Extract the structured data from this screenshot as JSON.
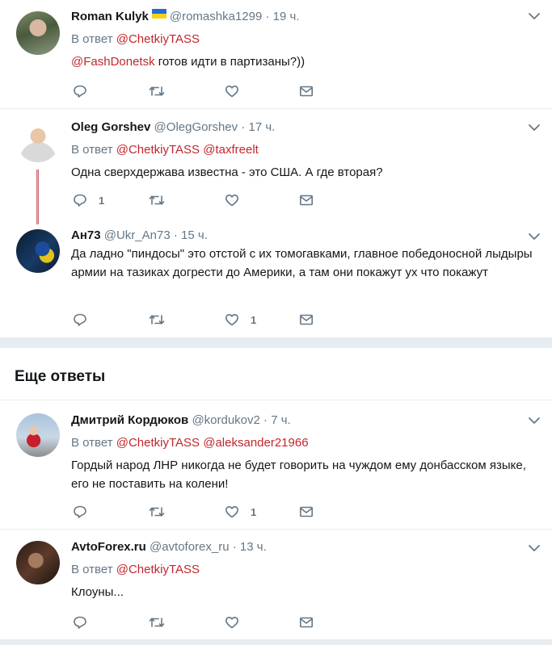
{
  "tweets": [
    {
      "name": "Roman Kulyk",
      "handle": "@romashka1299",
      "dot": "·",
      "time": "19 ч.",
      "reply_prefix": "В ответ",
      "reply_to": [
        "@ChetkiyTASS"
      ],
      "text_mention": "@FashDonetsk",
      "text": " готов идти в партизаны?))",
      "reply_count": "",
      "like_count": ""
    },
    {
      "name": "Oleg Gorshev",
      "handle": "@OlegGorshev",
      "dot": "·",
      "time": "17 ч.",
      "reply_prefix": "В ответ",
      "reply_to": [
        "@ChetkiyTASS",
        "@taxfreelt"
      ],
      "text": "Одна сверхдержава известна - это США. А где вторая?",
      "reply_count": "1",
      "like_count": ""
    },
    {
      "name": "Ан73",
      "handle": "@Ukr_An73",
      "dot": "·",
      "time": "15 ч.",
      "text": "Да ладно \"пиндосы\" это отстой с их томогавками, главное победоносной лыдыры армии на тазиках догрести до Америки, а там они покажут ух что покажут",
      "reply_count": "",
      "like_count": "1"
    },
    {
      "name": "Дмитрий Кордюков",
      "handle": "@kordukov2",
      "dot": "·",
      "time": "7 ч.",
      "reply_prefix": "В ответ",
      "reply_to": [
        "@ChetkiyTASS",
        "@aleksander21966"
      ],
      "text": "Гордый народ ЛНР никогда не будет говорить на чуждом ему донбасском языке, его не поставить на колени!",
      "reply_count": "",
      "like_count": "1"
    },
    {
      "name": "AvtoForex.ru",
      "handle": "@avtoforex_ru",
      "dot": "·",
      "time": "13 ч.",
      "reply_prefix": "В ответ",
      "reply_to": [
        "@ChetkiyTASS"
      ],
      "text": "Клоуны...",
      "reply_count": "",
      "like_count": ""
    }
  ],
  "more_replies_title": "Еще ответы",
  "colors": {
    "mention": "#c0272d",
    "muted": "#657786",
    "divider": "#e6ecf0",
    "text": "#14171a"
  },
  "icons": [
    "reply-icon",
    "retweet-icon",
    "like-icon",
    "message-icon",
    "chevron-down-icon",
    "ukraine-flag-icon"
  ]
}
